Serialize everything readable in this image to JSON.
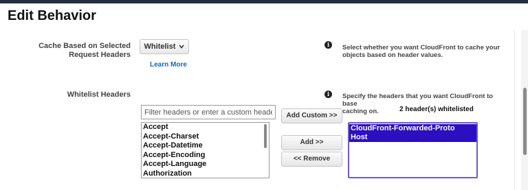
{
  "page": {
    "title": "Edit Behavior"
  },
  "cache_setting": {
    "label_line1": "Cache Based on Selected",
    "label_line2": "Request Headers",
    "dropdown_value": "Whitelist",
    "learn_more": "Learn More",
    "help_line1": "Select whether you want CloudFront to cache your",
    "help_line2": "objects based on header values."
  },
  "whitelist": {
    "label": "Whitelist Headers",
    "help_line1": "Specify the headers that you want CloudFront to base",
    "help_line2": "caching on.",
    "filter_placeholder": "Filter headers or enter a custom header",
    "available_headers": [
      "Accept",
      "Accept-Charset",
      "Accept-Datetime",
      "Accept-Encoding",
      "Accept-Language",
      "Authorization"
    ],
    "add_custom_label": "Add Custom >>",
    "add_label": "Add >>",
    "remove_label": "<< Remove",
    "count_text": "2 header(s) whitelisted",
    "selected_headers": [
      "CloudFront-Forwarded-Proto",
      "Host"
    ]
  },
  "icons": {
    "info": "info-icon",
    "dropdown_caret": "chevron-down-icon"
  }
}
